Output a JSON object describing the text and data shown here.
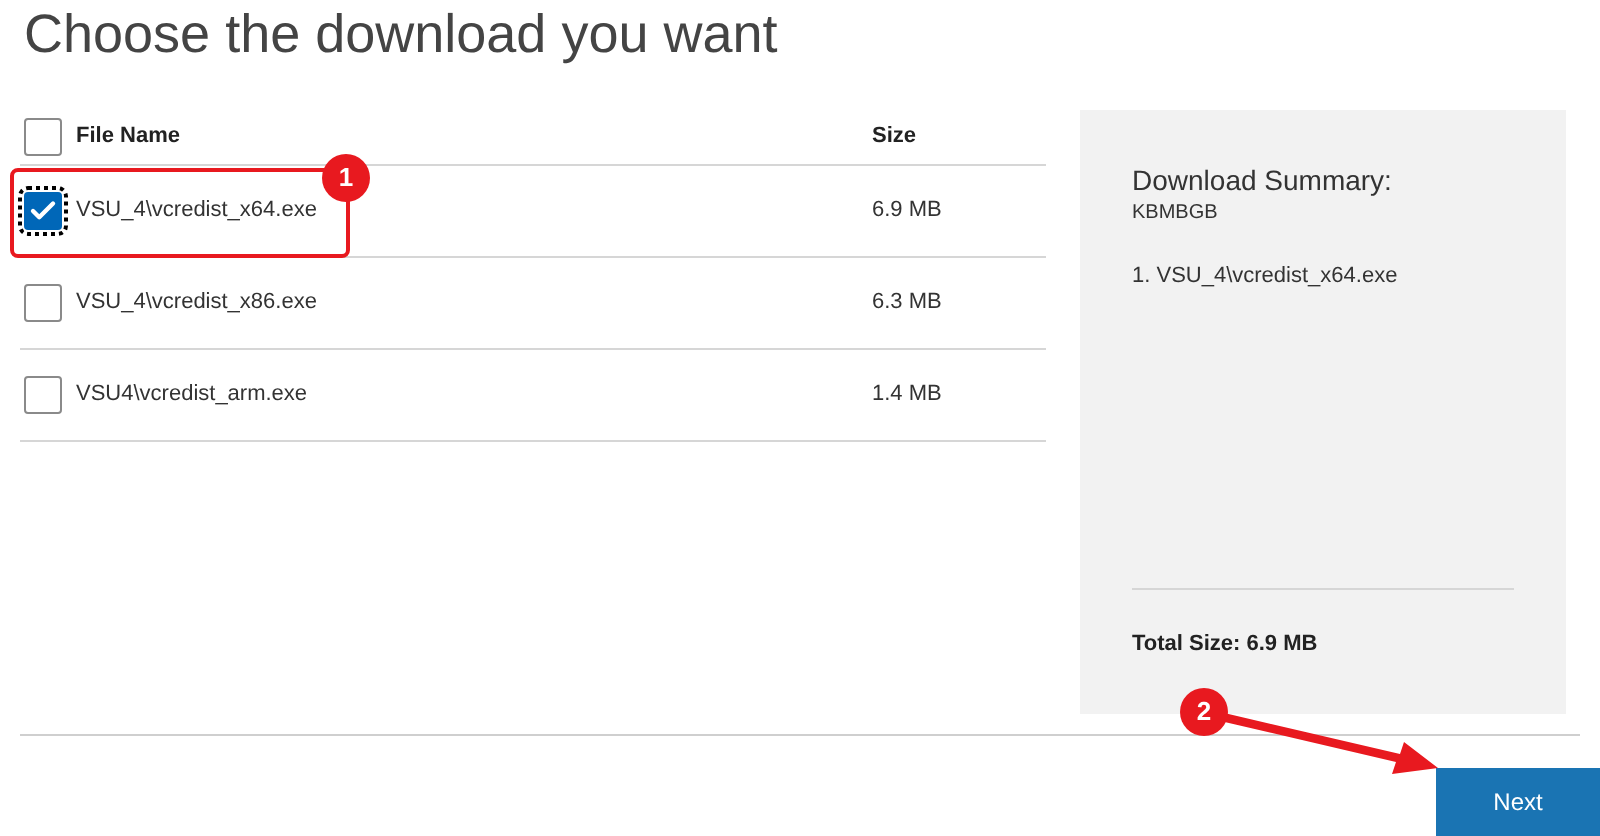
{
  "title": "Choose the download you want",
  "table": {
    "columns": [
      "File Name",
      "Size"
    ],
    "select_all": {
      "checked": false
    },
    "rows": [
      {
        "name": "VSU_4\\vcredist_x64.exe",
        "size": "6.9 MB",
        "selected": true
      },
      {
        "name": "VSU_4\\vcredist_x86.exe",
        "size": "6.3 MB",
        "selected": false
      },
      {
        "name": "VSU4\\vcredist_arm.exe",
        "size": "1.4 MB",
        "selected": false
      }
    ]
  },
  "summary": {
    "title": "Download Summary:",
    "subtitle": "KBMBGB",
    "items": [
      "1. VSU_4\\vcredist_x64.exe"
    ],
    "total": "Total Size: 6.9 MB"
  },
  "next_button": "Next",
  "annotations": [
    {
      "number": "1"
    },
    {
      "number": "2"
    }
  ]
}
